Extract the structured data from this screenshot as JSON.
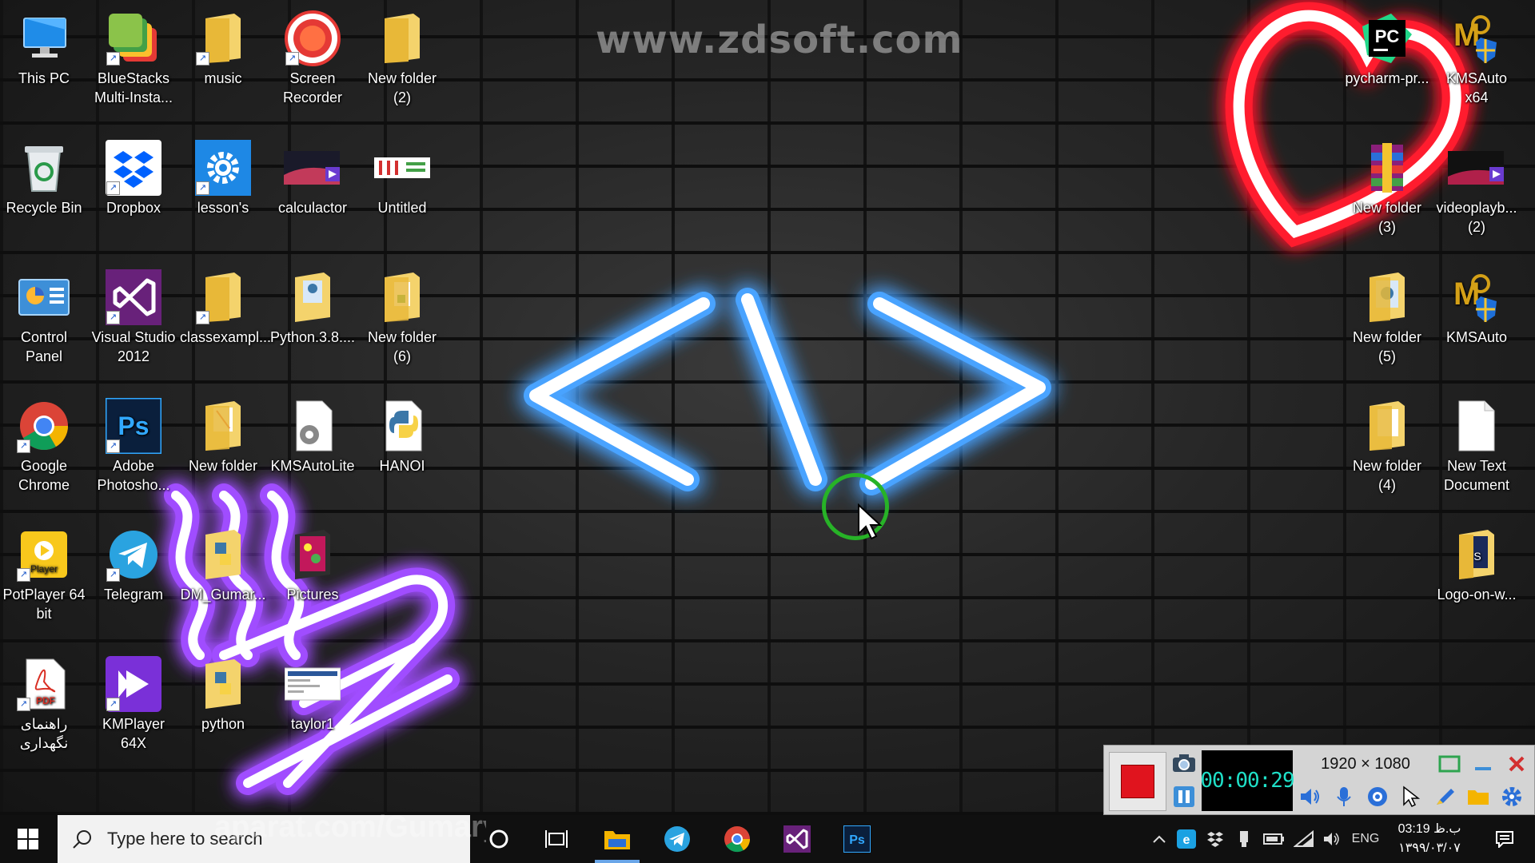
{
  "wallpaper": {
    "watermark": "www.zdsoft.com",
    "overlay_watermark": "aparat.com/GumaryaN"
  },
  "desktop_icons": [
    {
      "label": "This PC",
      "icon": "pc-icon"
    },
    {
      "label": "BlueStacks Multi-Insta...",
      "icon": "bluestacks-icon"
    },
    {
      "label": "music",
      "icon": "folder-icon"
    },
    {
      "label": "Screen Recorder",
      "icon": "screen-recorder-icon"
    },
    {
      "label": "New folder (2)",
      "icon": "folder-icon"
    },
    {
      "label": "Recycle Bin",
      "icon": "recycle-bin-icon"
    },
    {
      "label": "Dropbox",
      "icon": "dropbox-icon"
    },
    {
      "label": "lesson's",
      "icon": "settings-gear-icon"
    },
    {
      "label": "calculactor",
      "icon": "video-file-icon"
    },
    {
      "label": "Untitled",
      "icon": "image-file-icon"
    },
    {
      "label": "Control Panel",
      "icon": "control-panel-icon"
    },
    {
      "label": "Visual Studio 2012",
      "icon": "visual-studio-icon"
    },
    {
      "label": "classexampl...",
      "icon": "folder-icon"
    },
    {
      "label": "Python.3.8....",
      "icon": "folder-icon"
    },
    {
      "label": "New folder (6)",
      "icon": "folder-icon"
    },
    {
      "label": "Google Chrome",
      "icon": "chrome-icon"
    },
    {
      "label": "Adobe Photosho...",
      "icon": "photoshop-icon"
    },
    {
      "label": "New folder",
      "icon": "folder-icon"
    },
    {
      "label": "KMSAutoLite",
      "icon": "kmsauto-file-icon"
    },
    {
      "label": "HANOI",
      "icon": "python-file-icon"
    },
    {
      "label": "PotPlayer 64 bit",
      "icon": "potplayer-icon"
    },
    {
      "label": "Telegram",
      "icon": "telegram-icon"
    },
    {
      "label": "DM_Gumar...",
      "icon": "python-file-icon"
    },
    {
      "label": "Pictures",
      "icon": "folder-icon"
    },
    {
      "label": "راهنمای نگهداری",
      "icon": "pdf-icon"
    },
    {
      "label": "KMPlayer 64X",
      "icon": "kmplayer-icon"
    },
    {
      "label": "python",
      "icon": "folder-icon"
    },
    {
      "label": "taylor1",
      "icon": "image-file-icon"
    },
    {
      "label": "pycharm-pr...",
      "icon": "pycharm-icon"
    },
    {
      "label": "KMSAuto x64",
      "icon": "kmsauto-icon"
    },
    {
      "label": "New folder (3)",
      "icon": "winrar-icon"
    },
    {
      "label": "videoplayb... (2)",
      "icon": "video-file-icon"
    },
    {
      "label": "New folder (5)",
      "icon": "folder-icon"
    },
    {
      "label": "KMSAuto",
      "icon": "kmsauto-icon"
    },
    {
      "label": "New folder (4)",
      "icon": "folder-icon"
    },
    {
      "label": "New Text Document",
      "icon": "text-file-icon"
    },
    {
      "label": "Logo-on-w...",
      "icon": "folder-icon"
    }
  ],
  "recorder": {
    "timer": "00:00:29",
    "resolution": "1920 × 1080"
  },
  "taskbar": {
    "search_placeholder": "Type here to search",
    "apps": [
      "file-explorer-icon",
      "telegram-icon",
      "chrome-icon",
      "visual-studio-icon",
      "photoshop-icon"
    ],
    "language": "ENG",
    "time": "03:19 ب.ظ",
    "date": "۱۳۹۹/۰۳/۰۷"
  },
  "colors": {
    "neon_blue": "#4aa3ff",
    "neon_red": "#ff1e2e",
    "neon_purple": "#a04dff",
    "record_red": "#e0141e",
    "timer_text": "#1fe0c8",
    "cursor_ring": "#27b327"
  }
}
